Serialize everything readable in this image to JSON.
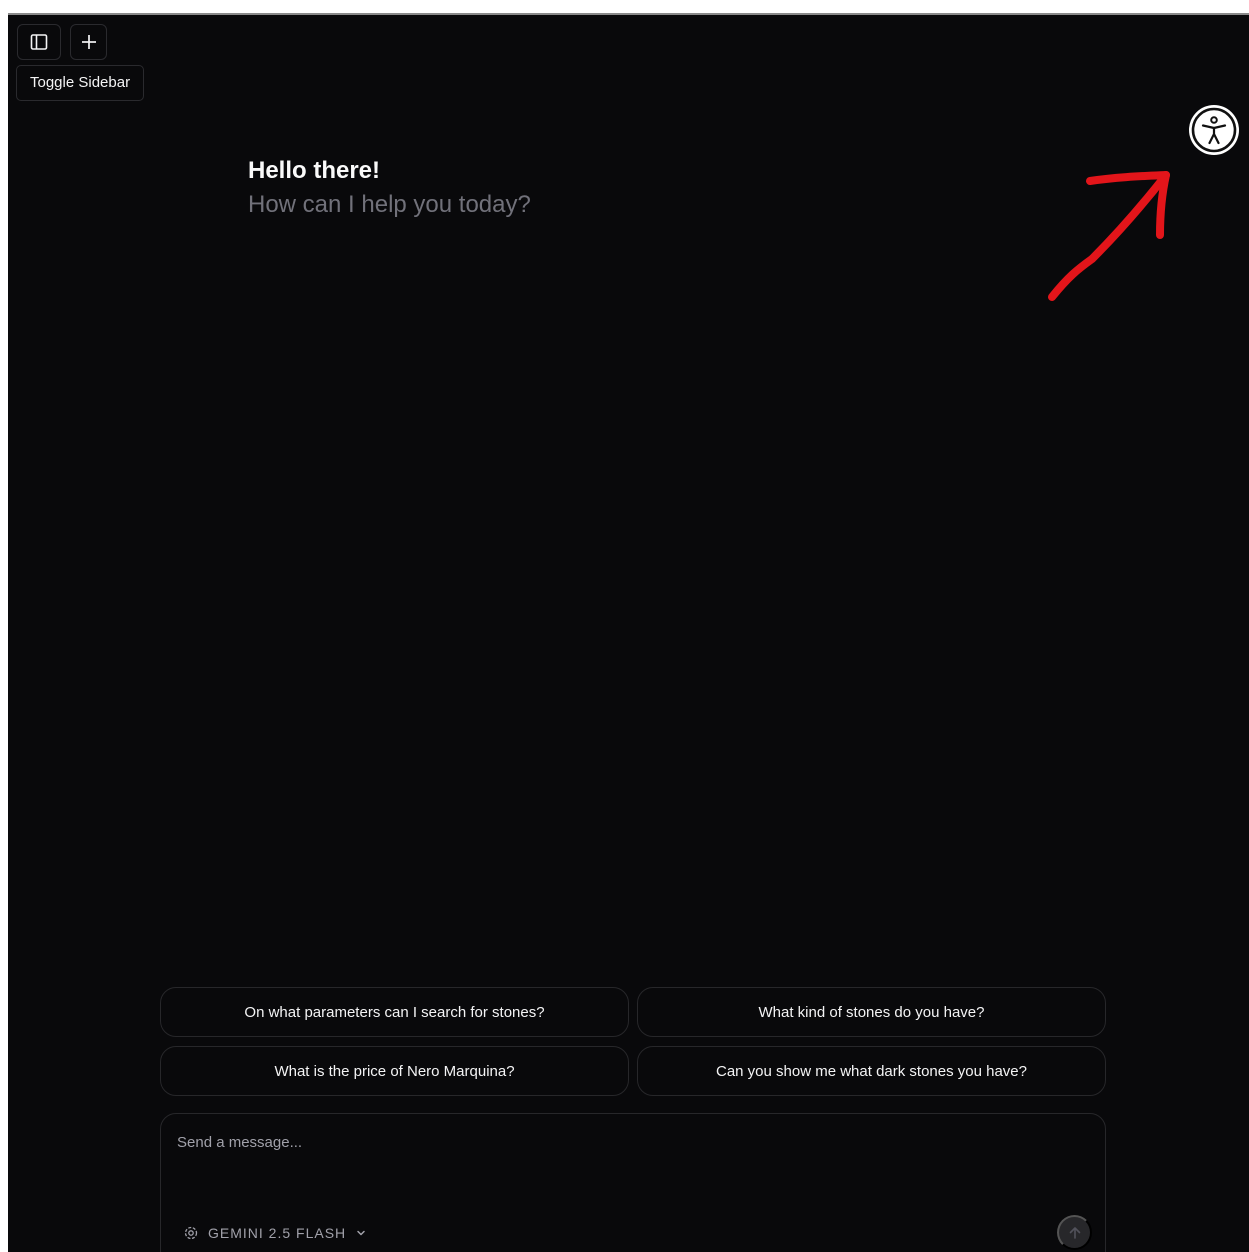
{
  "toolbar": {
    "sidebar_icon": "sidebar-icon",
    "new_chat_icon": "plus-icon",
    "tooltip": "Toggle Sidebar"
  },
  "greeting": {
    "title": "Hello there!",
    "subtitle": "How can I help you today?"
  },
  "accessibility": {
    "icon": "accessibility-icon"
  },
  "annotation": {
    "icon": "arrow-annotation",
    "color": "#e3151a"
  },
  "suggestions": [
    "On what parameters can I search for stones?",
    "What kind of stones do you have?",
    "What is the price of Nero Marquina?",
    "Can you show me what dark stones you have?"
  ],
  "composer": {
    "placeholder": "Send a message...",
    "model_icon": "model-chip-icon",
    "model": "GEMINI 2.5 FLASH",
    "model_dropdown_icon": "chevron-down-icon",
    "send_icon": "arrow-up-icon"
  },
  "colors": {
    "background": "#09090b",
    "border": "#27272a",
    "muted_text": "#71717a"
  }
}
